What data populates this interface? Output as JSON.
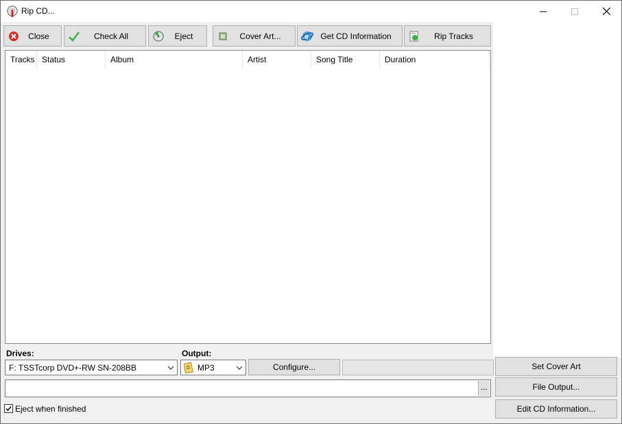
{
  "window": {
    "title": "Rip CD..."
  },
  "toolbar": {
    "close": "Close",
    "check_all": "Check All",
    "eject": "Eject",
    "cover_art": "Cover Art...",
    "get_cd_info": "Get CD Information",
    "rip_tracks": "Rip Tracks"
  },
  "table": {
    "columns": [
      "Tracks",
      "Status",
      "Album",
      "Artist",
      "Song Title",
      "Duration"
    ],
    "rows": []
  },
  "drives": {
    "label": "Drives:",
    "value": "F: TSSTcorp DVD+-RW SN-208BB"
  },
  "output": {
    "label": "Output:",
    "value": "MP3"
  },
  "buttons": {
    "configure": "Configure...",
    "set_cover_art": "Set Cover Art",
    "file_output": "File Output...",
    "edit_cd_info": "Edit CD Information...",
    "browse": "..."
  },
  "path": {
    "value": ""
  },
  "eject_when_finished": {
    "label": "Eject when finished",
    "checked": true
  },
  "colors": {
    "accent_red": "#d32f2f",
    "check_green": "#3cb043",
    "button_bg": "#e1e1e1"
  }
}
